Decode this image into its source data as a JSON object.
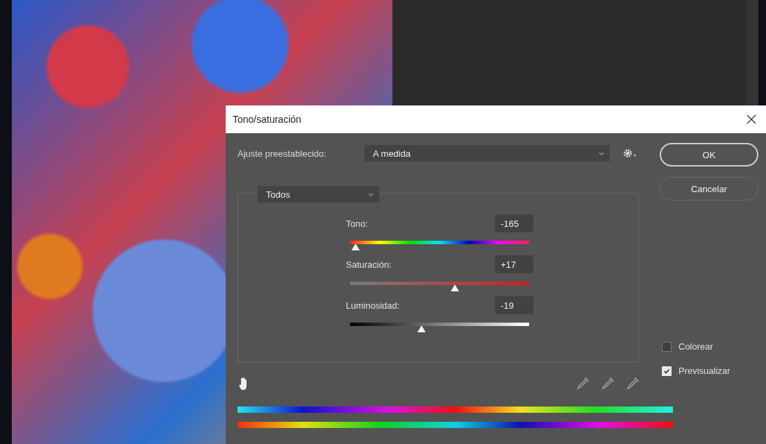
{
  "window": {
    "title": "Tono/saturación"
  },
  "preset": {
    "label": "Ajuste preestablecido:",
    "value": "A medida"
  },
  "buttons": [
    {
      "label": "OK",
      "default": true
    },
    {
      "label": "Cancelar",
      "default": false
    }
  ],
  "channel": {
    "value": "Todos"
  },
  "sliders": [
    {
      "kind": "hue",
      "label": "Tono:",
      "value": "-165",
      "level": 0.03
    },
    {
      "kind": "saturation",
      "label": "Saturación:",
      "value": "+17",
      "level": 0.585
    },
    {
      "kind": "lightness",
      "label": "Luminosidad:",
      "value": "-19",
      "level": 0.4
    }
  ],
  "options": [
    {
      "label": "Colorear",
      "checked": false
    },
    {
      "label": "Previsualizar",
      "checked": true
    }
  ]
}
